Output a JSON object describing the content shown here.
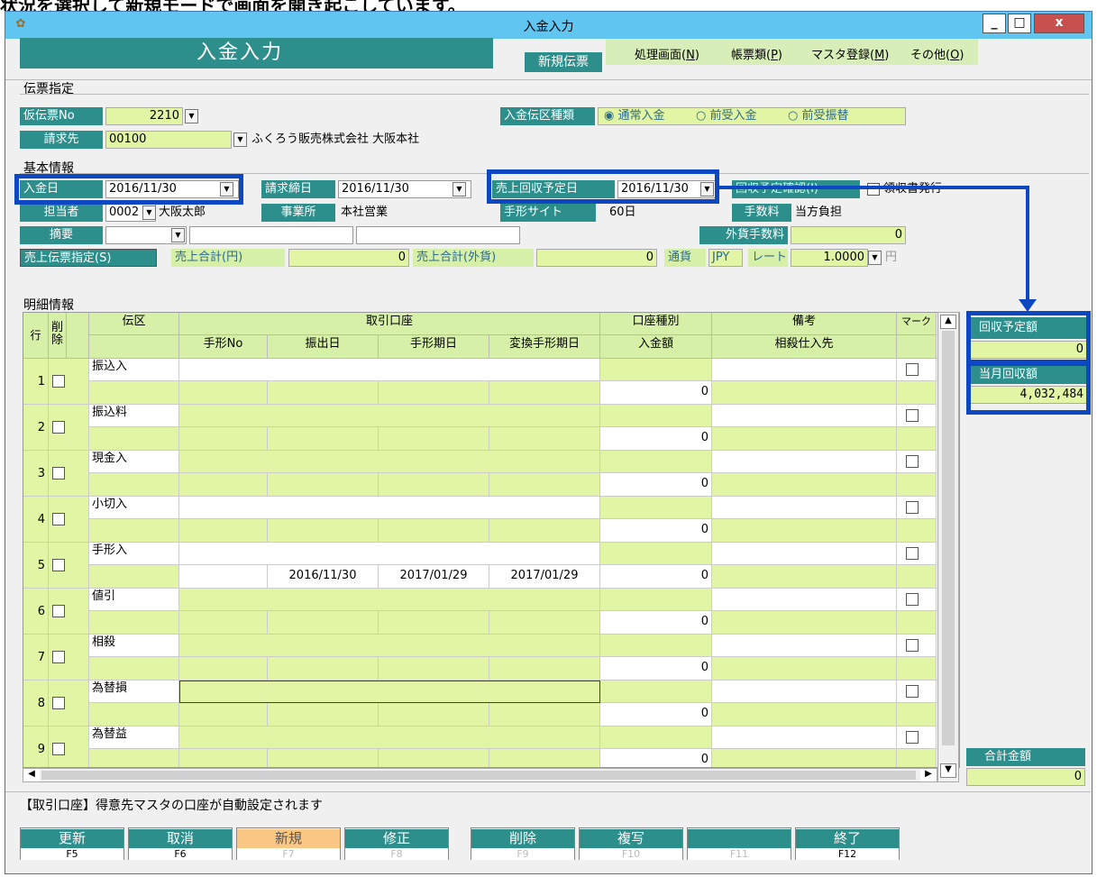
{
  "caption_top": "状況を選択して新規モードで画面を開き起こしています。",
  "window": {
    "title": "入金入力",
    "min": "_",
    "max": "□",
    "close": "x"
  },
  "header": {
    "app_name": "入金入力",
    "new_badge": "新規伝票",
    "menu": [
      {
        "label": "処理画面(",
        "key": "N",
        "end": ")"
      },
      {
        "label": "帳票類(",
        "key": "P",
        "end": ")"
      },
      {
        "label": "マスタ登録(",
        "key": "M",
        "end": ")"
      },
      {
        "label": "その他(",
        "key": "O",
        "end": ")"
      }
    ]
  },
  "voucher": {
    "section": "伝票指定",
    "temp_no_label": "仮伝票No",
    "temp_no": "2210",
    "billing_label": "請求先",
    "billing_code": "00100",
    "billing_name": "ふくろう販売株式会社 大阪本社",
    "type_label": "入金伝区種類",
    "type_options": [
      "通常入金",
      "前受入金",
      "前受振替"
    ]
  },
  "basic": {
    "section": "基本情報",
    "date_label": "入金日",
    "date": "2016/11/30",
    "close_label": "請求締日",
    "close_date": "2016/11/30",
    "plan_label": "売上回収予定日",
    "plan_date": "2016/11/30",
    "confirm_button": "回収予定確認(I)",
    "receipt_label": "領収書発行",
    "staff_label": "担当者",
    "staff_code": "0002",
    "staff_name": "大阪太郎",
    "office_label": "事業所",
    "office": "本社営業",
    "note_site_label": "手形サイト",
    "note_site": "60日",
    "fee_label": "手数料",
    "fee": "当方負担",
    "memo_label": "摘要",
    "fx_fee_label": "外貨手数料",
    "fx_fee": "0",
    "sales_button": "売上伝票指定(S)",
    "sales_yen_label": "売上合計(円)",
    "sales_yen": "0",
    "sales_fx_label": "売上合計(外貨)",
    "sales_fx": "0",
    "currency_label": "通貨",
    "currency": "JPY",
    "rate_label": "レート",
    "rate": "1.0000",
    "yen": "円"
  },
  "detail": {
    "section": "明細情報",
    "headers": {
      "row_no": "行No",
      "del": "削除",
      "kind": "伝区",
      "account": "取引口座",
      "acct_type": "口座種別",
      "memo": "備考",
      "mark": "マーク",
      "note_no": "手形No",
      "issue": "振出日",
      "due": "手形期日",
      "conv_due": "変換手形期日",
      "amount": "入金額",
      "offset": "相殺仕入先"
    },
    "rows": [
      {
        "no": "1",
        "kind": "振込入",
        "amount": "0",
        "issue": "",
        "due": "",
        "conv": ""
      },
      {
        "no": "2",
        "kind": "振込料",
        "amount": "0",
        "issue": "",
        "due": "",
        "conv": ""
      },
      {
        "no": "3",
        "kind": "現金入",
        "amount": "0",
        "issue": "",
        "due": "",
        "conv": ""
      },
      {
        "no": "4",
        "kind": "小切入",
        "amount": "0",
        "issue": "",
        "due": "",
        "conv": ""
      },
      {
        "no": "5",
        "kind": "手形入",
        "amount": "0",
        "issue": "2016/11/30",
        "due": "2017/01/29",
        "conv": "2017/01/29"
      },
      {
        "no": "6",
        "kind": "値引",
        "amount": "0",
        "issue": "",
        "due": "",
        "conv": ""
      },
      {
        "no": "7",
        "kind": "相殺",
        "amount": "0",
        "issue": "",
        "due": "",
        "conv": ""
      },
      {
        "no": "8",
        "kind": "為替損",
        "amount": "0",
        "issue": "",
        "due": "",
        "conv": ""
      },
      {
        "no": "9",
        "kind": "為替益",
        "amount": "0",
        "issue": "",
        "due": "",
        "conv": ""
      }
    ]
  },
  "side": {
    "plan_label": "回収予定額",
    "plan_value": "0",
    "month_label": "当月回収額",
    "month_value": "4,032,484",
    "total_label": "合計金額",
    "total_value": "0"
  },
  "status_msg": "【取引口座】得意先マスタの口座が自動設定されます",
  "fkeys": [
    {
      "label": "更新",
      "key": "F5"
    },
    {
      "label": "取消",
      "key": "F6"
    },
    {
      "label": "新規",
      "key": "F7"
    },
    {
      "label": "修正",
      "key": "F8"
    },
    {
      "label": "削除",
      "key": "F9"
    },
    {
      "label": "複写",
      "key": "F10"
    },
    {
      "label": "",
      "key": "F11"
    },
    {
      "label": "終了",
      "key": "F12"
    }
  ],
  "colors": {
    "teal": "#2d8f8c",
    "light_green": "#e1f5a5",
    "title_blue": "#60c5f0",
    "highlight_blue": "#0d47c2",
    "new_orange": "#fbc784"
  }
}
